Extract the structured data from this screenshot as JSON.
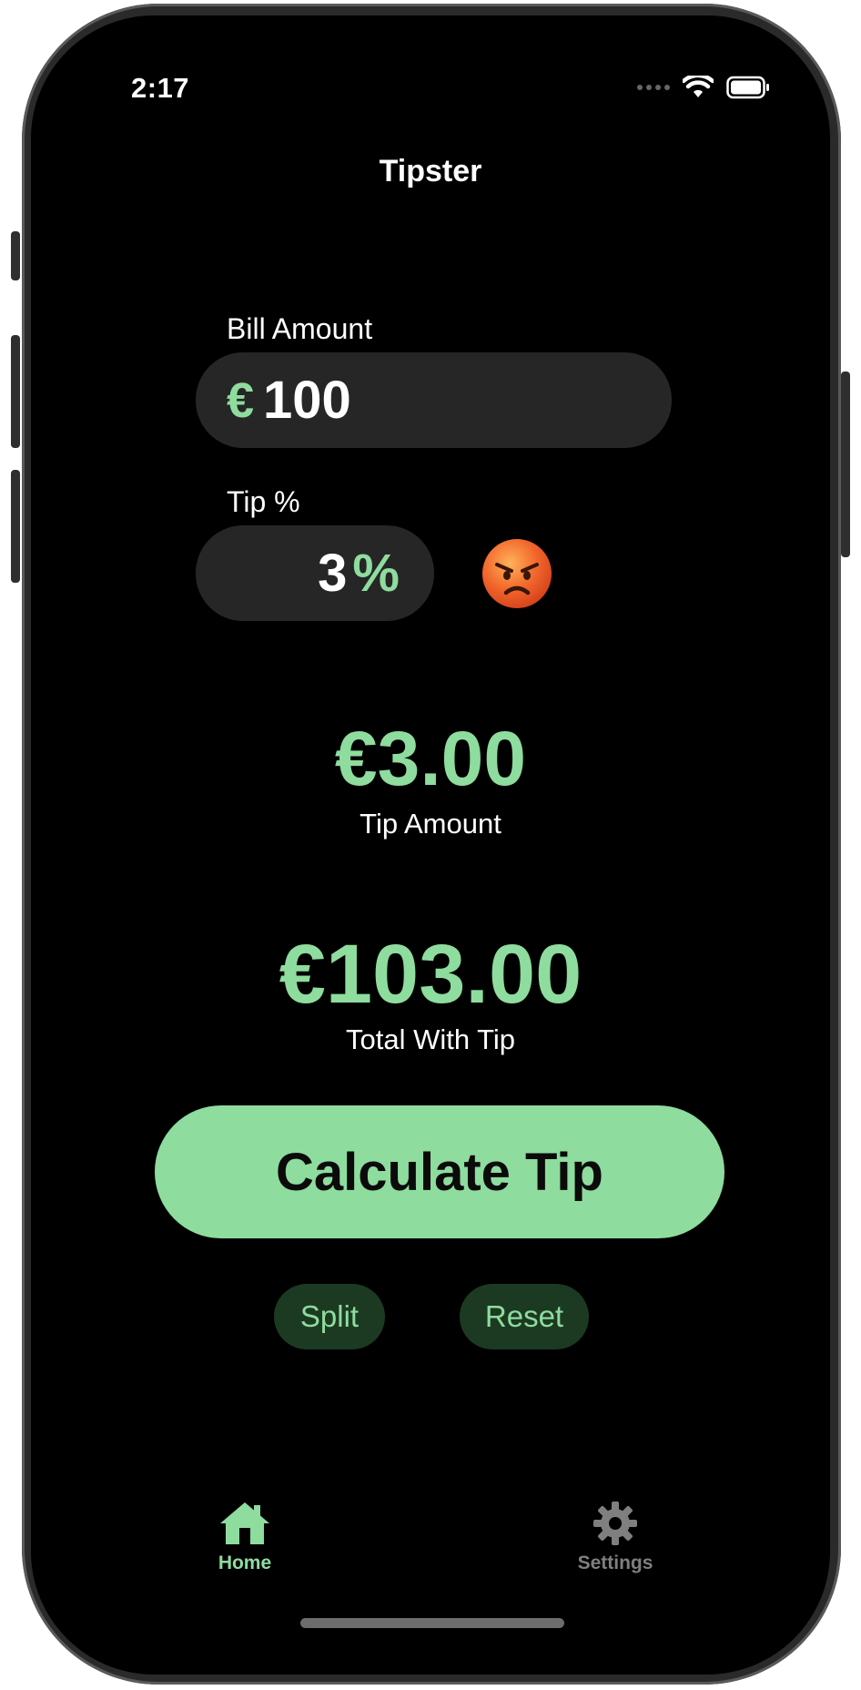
{
  "status_bar": {
    "time": "2:17",
    "icons": [
      "cellular-signal-icon",
      "wifi-icon",
      "battery-icon"
    ]
  },
  "nav": {
    "title": "Tipster"
  },
  "bill": {
    "label": "Bill Amount",
    "currency_symbol": "€",
    "value": "100"
  },
  "tip": {
    "label": "Tip %",
    "value": "3",
    "suffix": "%",
    "mood_emoji": "😡"
  },
  "results": {
    "tip_amount": "€3.00",
    "tip_amount_caption": "Tip Amount",
    "total": "€103.00",
    "total_caption": "Total With Tip"
  },
  "actions": {
    "calculate_label": "Calculate Tip",
    "split_label": "Split",
    "reset_label": "Reset"
  },
  "tab_bar": {
    "items": [
      {
        "label": "Home",
        "icon": "house-icon",
        "selected": true
      },
      {
        "label": "Settings",
        "icon": "gear-icon",
        "selected": false
      }
    ]
  },
  "colors": {
    "accent": "#8edc9e",
    "background": "#000000",
    "field_background": "#262626",
    "secondary_button_background": "#1c3a22",
    "inactive_tab": "#7f7f7f"
  }
}
